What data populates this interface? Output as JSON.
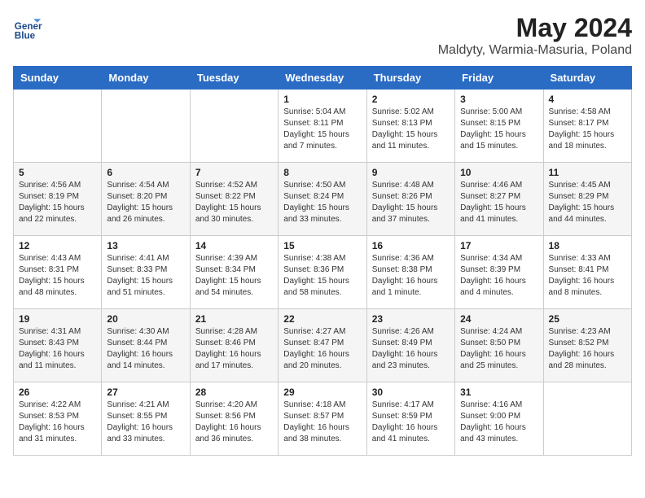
{
  "header": {
    "logo_line1": "General",
    "logo_line2": "Blue",
    "title": "May 2024",
    "subtitle": "Maldyty, Warmia-Masuria, Poland"
  },
  "days_of_week": [
    "Sunday",
    "Monday",
    "Tuesday",
    "Wednesday",
    "Thursday",
    "Friday",
    "Saturday"
  ],
  "weeks": [
    [
      {
        "day": "",
        "info": ""
      },
      {
        "day": "",
        "info": ""
      },
      {
        "day": "",
        "info": ""
      },
      {
        "day": "1",
        "info": "Sunrise: 5:04 AM\nSunset: 8:11 PM\nDaylight: 15 hours\nand 7 minutes."
      },
      {
        "day": "2",
        "info": "Sunrise: 5:02 AM\nSunset: 8:13 PM\nDaylight: 15 hours\nand 11 minutes."
      },
      {
        "day": "3",
        "info": "Sunrise: 5:00 AM\nSunset: 8:15 PM\nDaylight: 15 hours\nand 15 minutes."
      },
      {
        "day": "4",
        "info": "Sunrise: 4:58 AM\nSunset: 8:17 PM\nDaylight: 15 hours\nand 18 minutes."
      }
    ],
    [
      {
        "day": "5",
        "info": "Sunrise: 4:56 AM\nSunset: 8:19 PM\nDaylight: 15 hours\nand 22 minutes."
      },
      {
        "day": "6",
        "info": "Sunrise: 4:54 AM\nSunset: 8:20 PM\nDaylight: 15 hours\nand 26 minutes."
      },
      {
        "day": "7",
        "info": "Sunrise: 4:52 AM\nSunset: 8:22 PM\nDaylight: 15 hours\nand 30 minutes."
      },
      {
        "day": "8",
        "info": "Sunrise: 4:50 AM\nSunset: 8:24 PM\nDaylight: 15 hours\nand 33 minutes."
      },
      {
        "day": "9",
        "info": "Sunrise: 4:48 AM\nSunset: 8:26 PM\nDaylight: 15 hours\nand 37 minutes."
      },
      {
        "day": "10",
        "info": "Sunrise: 4:46 AM\nSunset: 8:27 PM\nDaylight: 15 hours\nand 41 minutes."
      },
      {
        "day": "11",
        "info": "Sunrise: 4:45 AM\nSunset: 8:29 PM\nDaylight: 15 hours\nand 44 minutes."
      }
    ],
    [
      {
        "day": "12",
        "info": "Sunrise: 4:43 AM\nSunset: 8:31 PM\nDaylight: 15 hours\nand 48 minutes."
      },
      {
        "day": "13",
        "info": "Sunrise: 4:41 AM\nSunset: 8:33 PM\nDaylight: 15 hours\nand 51 minutes."
      },
      {
        "day": "14",
        "info": "Sunrise: 4:39 AM\nSunset: 8:34 PM\nDaylight: 15 hours\nand 54 minutes."
      },
      {
        "day": "15",
        "info": "Sunrise: 4:38 AM\nSunset: 8:36 PM\nDaylight: 15 hours\nand 58 minutes."
      },
      {
        "day": "16",
        "info": "Sunrise: 4:36 AM\nSunset: 8:38 PM\nDaylight: 16 hours\nand 1 minute."
      },
      {
        "day": "17",
        "info": "Sunrise: 4:34 AM\nSunset: 8:39 PM\nDaylight: 16 hours\nand 4 minutes."
      },
      {
        "day": "18",
        "info": "Sunrise: 4:33 AM\nSunset: 8:41 PM\nDaylight: 16 hours\nand 8 minutes."
      }
    ],
    [
      {
        "day": "19",
        "info": "Sunrise: 4:31 AM\nSunset: 8:43 PM\nDaylight: 16 hours\nand 11 minutes."
      },
      {
        "day": "20",
        "info": "Sunrise: 4:30 AM\nSunset: 8:44 PM\nDaylight: 16 hours\nand 14 minutes."
      },
      {
        "day": "21",
        "info": "Sunrise: 4:28 AM\nSunset: 8:46 PM\nDaylight: 16 hours\nand 17 minutes."
      },
      {
        "day": "22",
        "info": "Sunrise: 4:27 AM\nSunset: 8:47 PM\nDaylight: 16 hours\nand 20 minutes."
      },
      {
        "day": "23",
        "info": "Sunrise: 4:26 AM\nSunset: 8:49 PM\nDaylight: 16 hours\nand 23 minutes."
      },
      {
        "day": "24",
        "info": "Sunrise: 4:24 AM\nSunset: 8:50 PM\nDaylight: 16 hours\nand 25 minutes."
      },
      {
        "day": "25",
        "info": "Sunrise: 4:23 AM\nSunset: 8:52 PM\nDaylight: 16 hours\nand 28 minutes."
      }
    ],
    [
      {
        "day": "26",
        "info": "Sunrise: 4:22 AM\nSunset: 8:53 PM\nDaylight: 16 hours\nand 31 minutes."
      },
      {
        "day": "27",
        "info": "Sunrise: 4:21 AM\nSunset: 8:55 PM\nDaylight: 16 hours\nand 33 minutes."
      },
      {
        "day": "28",
        "info": "Sunrise: 4:20 AM\nSunset: 8:56 PM\nDaylight: 16 hours\nand 36 minutes."
      },
      {
        "day": "29",
        "info": "Sunrise: 4:18 AM\nSunset: 8:57 PM\nDaylight: 16 hours\nand 38 minutes."
      },
      {
        "day": "30",
        "info": "Sunrise: 4:17 AM\nSunset: 8:59 PM\nDaylight: 16 hours\nand 41 minutes."
      },
      {
        "day": "31",
        "info": "Sunrise: 4:16 AM\nSunset: 9:00 PM\nDaylight: 16 hours\nand 43 minutes."
      },
      {
        "day": "",
        "info": ""
      }
    ]
  ]
}
